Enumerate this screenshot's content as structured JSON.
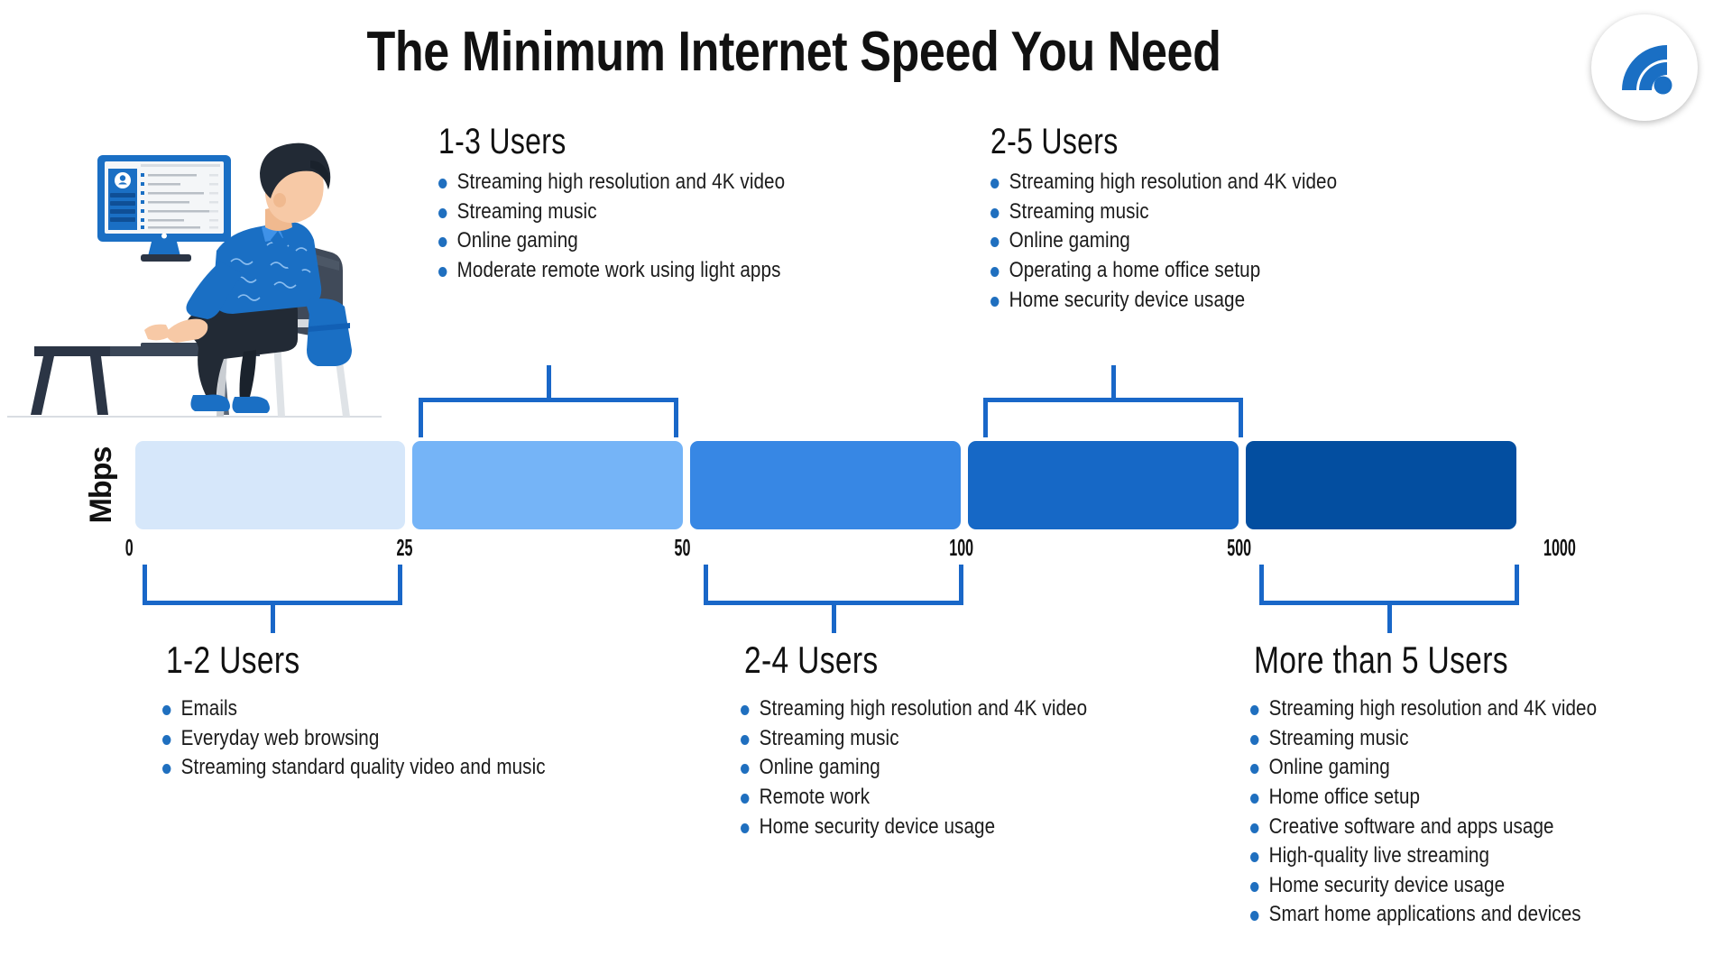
{
  "header": {
    "title": "The Minimum Internet Speed You Need",
    "logo_icon": "wifi-signal-icon"
  },
  "illustration": {
    "name": "person-at-desk-illustration"
  },
  "chart_data": {
    "type": "bar",
    "title": "The Minimum Internet Speed You Need",
    "ylabel": "Mbps",
    "xlabel": "",
    "orientation": "horizontal-segments",
    "grid": false,
    "legend": "none",
    "axis_ticks": [
      "0",
      "25",
      "50",
      "100",
      "500",
      "1000"
    ],
    "categories": [
      "0-25",
      "25-50",
      "50-100",
      "100-500",
      "500-1000"
    ],
    "values": [
      25,
      50,
      100,
      500,
      1000
    ],
    "colors": [
      "#D6E7FA",
      "#75B4F7",
      "#3787E4",
      "#1668C6",
      "#034EA0"
    ],
    "segments": [
      {
        "label": "0-25 Mbps",
        "from": 0,
        "to": 25,
        "color": "#D6E7FA"
      },
      {
        "label": "25-50 Mbps",
        "from": 25,
        "to": 50,
        "color": "#75B4F7"
      },
      {
        "label": "50-100 Mbps",
        "from": 50,
        "to": 100,
        "color": "#3787E4"
      },
      {
        "label": "100-500 Mbps",
        "from": 100,
        "to": 500,
        "color": "#1668C6"
      },
      {
        "label": "500-1000 Mbps",
        "from": 500,
        "to": 1000,
        "color": "#034EA0"
      }
    ]
  },
  "ticks": {
    "t0": "0",
    "t1": "25",
    "t2": "50",
    "t3": "100",
    "t4": "500",
    "t5": "1000"
  },
  "axis": {
    "unit_label": "Mbps"
  },
  "groups": {
    "users_1_3": {
      "heading": "1-3 Users",
      "items": [
        "Streaming high resolution and 4K video",
        "Streaming music",
        "Online gaming",
        "Moderate remote work using light apps"
      ]
    },
    "users_2_5": {
      "heading": "2-5 Users",
      "items": [
        "Streaming high resolution and 4K video",
        "Streaming music",
        "Online gaming",
        "Operating a home office setup",
        "Home security device usage"
      ]
    },
    "users_1_2": {
      "heading": "1-2 Users",
      "items": [
        "Emails",
        "Everyday web browsing",
        "Streaming standard quality video and music"
      ]
    },
    "users_2_4": {
      "heading": "2-4 Users",
      "items": [
        "Streaming high resolution and 4K video",
        "Streaming music",
        "Online gaming",
        "Remote work",
        "Home security device usage"
      ]
    },
    "users_5_plus": {
      "heading": "More than 5 Users",
      "items": [
        "Streaming high resolution and 4K video",
        "Streaming music",
        "Online gaming",
        "Home office setup",
        "Creative software and apps usage",
        "High-quality live streaming",
        "Home security device usage",
        "Smart home applications and devices"
      ]
    }
  },
  "colors": {
    "accent": "#1967C8",
    "bullet": "#1F6FBF",
    "text": "#111111",
    "logo_blue": "#1A6FC4"
  }
}
